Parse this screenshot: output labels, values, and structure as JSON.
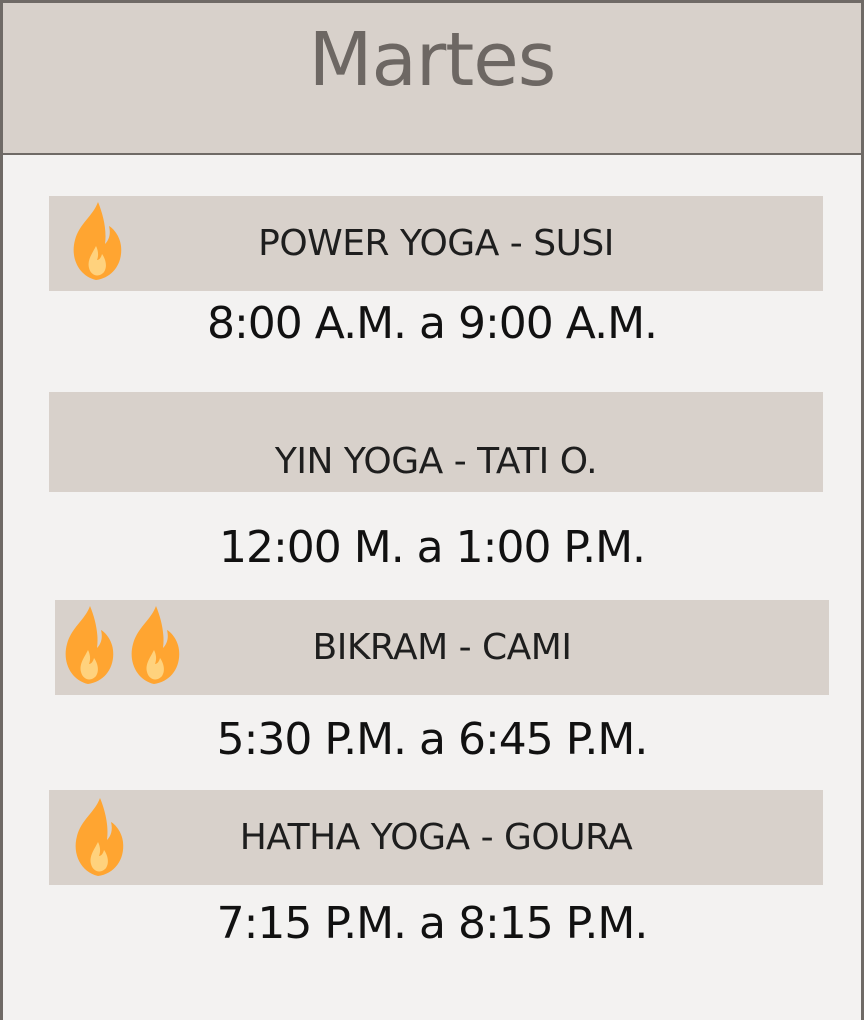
{
  "schedule": {
    "day": "Martes",
    "accent_color": "#ffa531",
    "band_color": "#d8d1cb",
    "classes": [
      {
        "name": "POWER YOGA - SUSI",
        "time": "8:00 A.M. a 9:00 A.M.",
        "intensity": 1,
        "icon": "flame-icon"
      },
      {
        "name": "YIN YOGA - TATI O.",
        "time": "12:00 M. a 1:00 P.M.",
        "intensity": 0,
        "icon": ""
      },
      {
        "name": "BIKRAM - CAMI",
        "time": "5:30 P.M. a 6:45 P.M.",
        "intensity": 2,
        "icon": "flame-icon"
      },
      {
        "name": "HATHA YOGA - GOURA",
        "time": "7:15 P.M. a 8:15 P.M.",
        "intensity": 1,
        "icon": "flame-icon"
      }
    ]
  }
}
